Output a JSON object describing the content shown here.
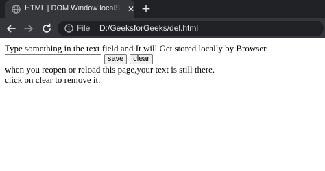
{
  "browser": {
    "tab": {
      "title": "HTML | DOM Window localStorage",
      "favicon": "globe-icon"
    },
    "toolbar": {
      "scheme_label": "File",
      "url": "D:/GeeksforGeeks/del.html"
    },
    "colors": {
      "tabbar_bg": "#202124",
      "toolbar_bg": "#35363a",
      "omnibox_bg": "#202124",
      "text": "#e8eaed"
    }
  },
  "page": {
    "intro": "Type something in the text field and It will Get stored locally by Browser",
    "input": {
      "value": "",
      "placeholder": ""
    },
    "save_label": "save",
    "clear_label": "clear",
    "line_reload": "when you reopen or reload this page,your text is still there.",
    "line_clear": "click on clear to remove it."
  }
}
